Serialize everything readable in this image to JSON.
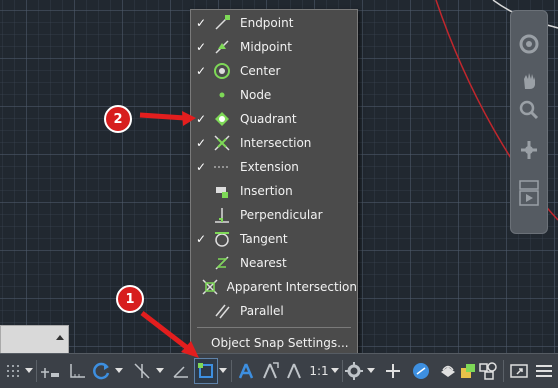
{
  "osnap_menu": {
    "items": [
      {
        "label": "Endpoint",
        "checked": true,
        "icon": "endpoint-snap-icon"
      },
      {
        "label": "Midpoint",
        "checked": true,
        "icon": "midpoint-snap-icon"
      },
      {
        "label": "Center",
        "checked": true,
        "icon": "center-snap-icon"
      },
      {
        "label": "Node",
        "checked": false,
        "icon": "node-snap-icon"
      },
      {
        "label": "Quadrant",
        "checked": true,
        "icon": "quadrant-snap-icon"
      },
      {
        "label": "Intersection",
        "checked": true,
        "icon": "intersection-snap-icon"
      },
      {
        "label": "Extension",
        "checked": true,
        "icon": "extension-snap-icon"
      },
      {
        "label": "Insertion",
        "checked": false,
        "icon": "insertion-snap-icon"
      },
      {
        "label": "Perpendicular",
        "checked": false,
        "icon": "perpendicular-snap-icon"
      },
      {
        "label": "Tangent",
        "checked": true,
        "icon": "tangent-snap-icon"
      },
      {
        "label": "Nearest",
        "checked": false,
        "icon": "nearest-snap-icon"
      },
      {
        "label": "Apparent Intersection",
        "checked": false,
        "icon": "apparent-intersection-snap-icon"
      },
      {
        "label": "Parallel",
        "checked": false,
        "icon": "parallel-snap-icon"
      }
    ],
    "check_glyph": "✓",
    "settings_label": "Object Snap Settings..."
  },
  "statusbar": {
    "annotation_scale": "1:1"
  },
  "callouts": {
    "one": "1",
    "two": "2"
  },
  "colors": {
    "accent_green": "#7ed957",
    "callout_red": "#d71e1e",
    "menu_bg": "#4b4b4b",
    "canvas_bg": "#212830",
    "status_blue": "#3d8fe0"
  }
}
